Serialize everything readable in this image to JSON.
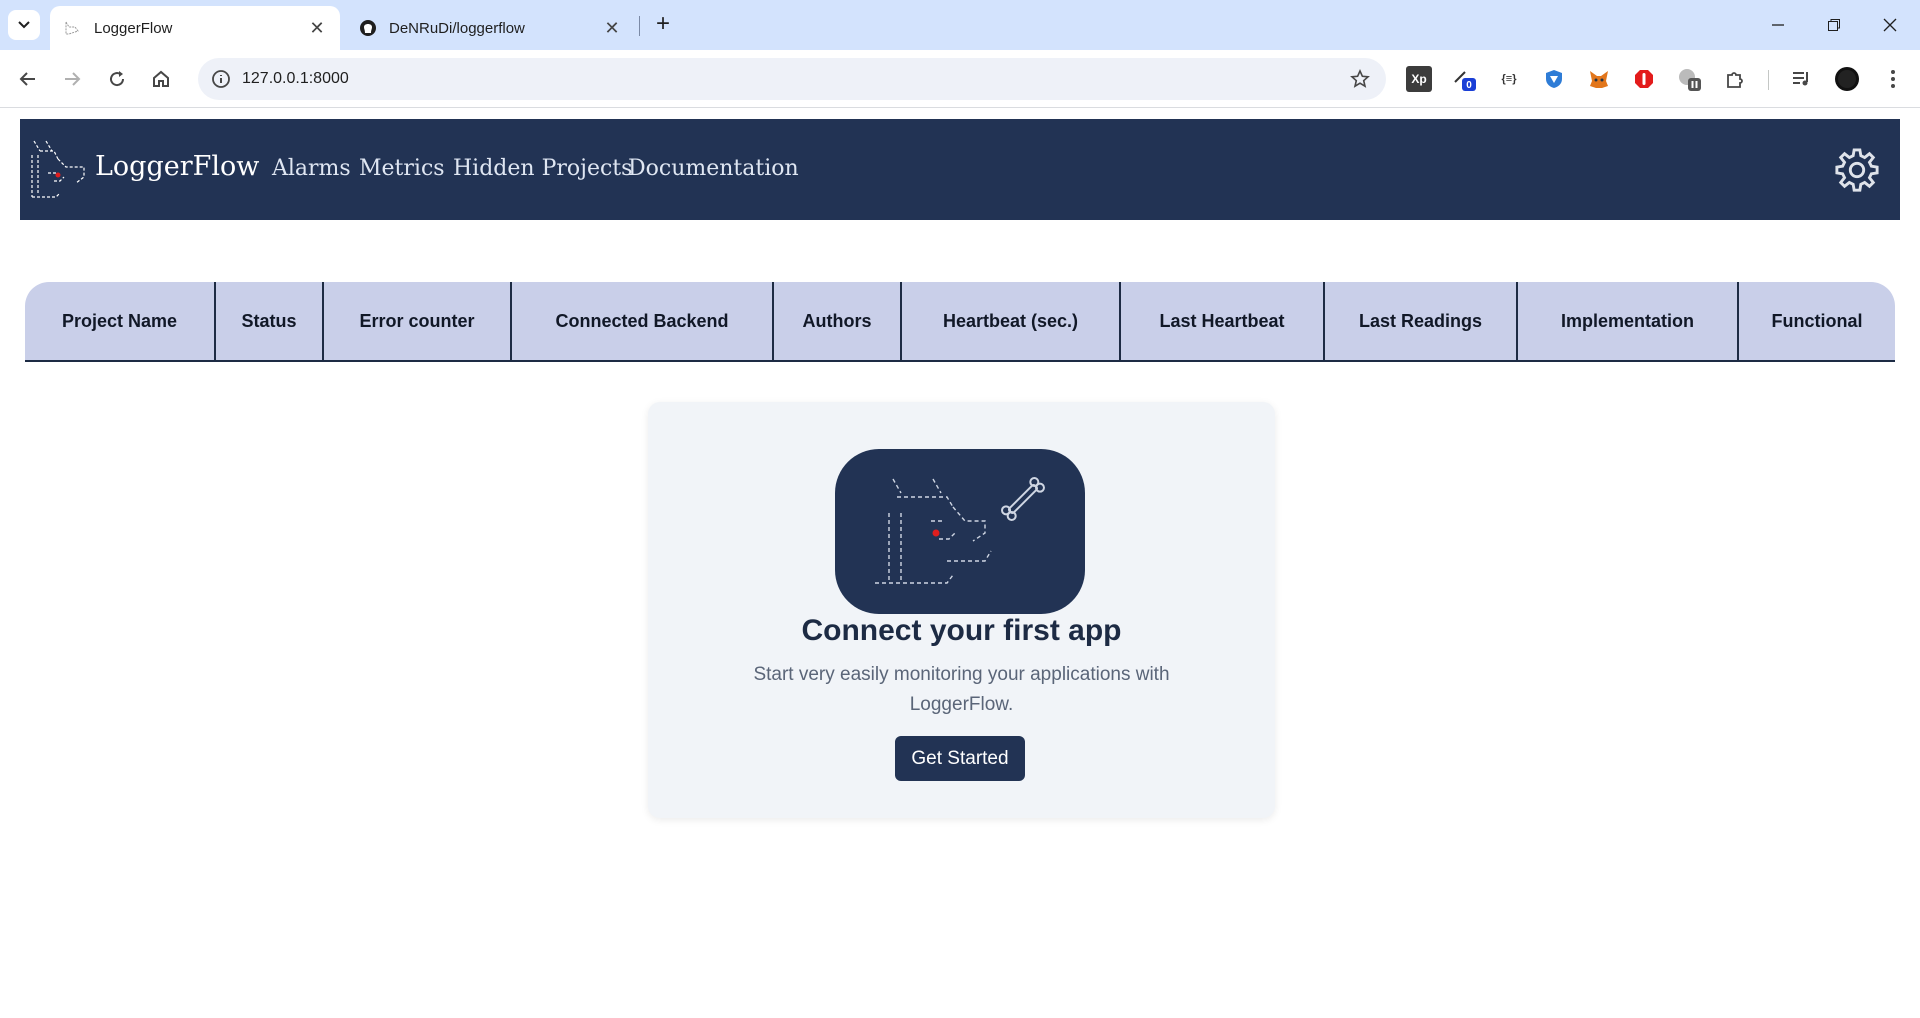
{
  "browser": {
    "tabs": [
      {
        "title": "LoggerFlow",
        "active": true,
        "icon": "loggerflow-favicon"
      },
      {
        "title": "DeNRuDi/loggerflow",
        "active": false,
        "icon": "github-icon"
      }
    ],
    "url": "127.0.0.1:8000",
    "extensions": [
      {
        "name": "xp-extension",
        "label": "Xp"
      },
      {
        "name": "counter-extension",
        "badge": "0"
      },
      {
        "name": "json-extension",
        "label": "{≡}"
      },
      {
        "name": "shield-extension"
      },
      {
        "name": "metamask-extension"
      },
      {
        "name": "opera-extension"
      },
      {
        "name": "paused-extension"
      },
      {
        "name": "puzzle-extension"
      }
    ]
  },
  "appbar": {
    "brand": "LoggerFlow",
    "nav": [
      "Alarms",
      "Metrics",
      "Hidden Projects",
      "Documentation"
    ],
    "settings_icon": "gear-icon"
  },
  "table": {
    "columns": [
      "Project Name",
      "Status",
      "Error counter",
      "Connected Backend",
      "Authors",
      "Heartbeat (sec.)",
      "Last Heartbeat",
      "Last Readings",
      "Implementation",
      "Functional"
    ]
  },
  "empty_state": {
    "title": "Connect your first app",
    "description": "Start very easily monitoring your applications with LoggerFlow.",
    "button": "Get Started"
  },
  "colors": {
    "navy": "#223354",
    "table_header": "#c9cfe9",
    "card_bg": "#f1f4f8",
    "tabstrip": "#d3e3fd"
  }
}
